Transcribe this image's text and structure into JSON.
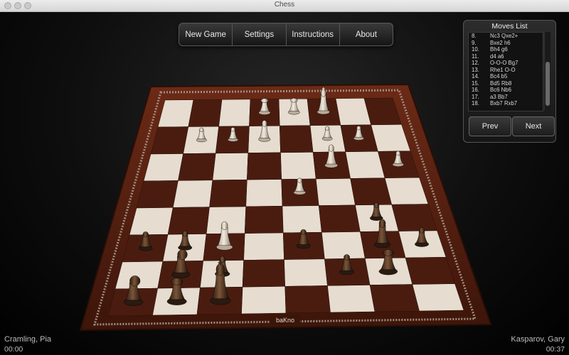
{
  "window": {
    "title": "Chess"
  },
  "menu": [
    {
      "label": "New Game",
      "name": "new-game-button"
    },
    {
      "label": "Settings",
      "name": "settings-button"
    },
    {
      "label": "Instructions",
      "name": "instructions-button"
    },
    {
      "label": "About",
      "name": "about-button"
    }
  ],
  "moves_panel": {
    "title": "Moves List",
    "moves": [
      {
        "num": "8.",
        "text": "Nc3 Qxe2+"
      },
      {
        "num": "9.",
        "text": "Bxe2 h6"
      },
      {
        "num": "10.",
        "text": "Bh4 g6"
      },
      {
        "num": "11.",
        "text": "d4 a6"
      },
      {
        "num": "12.",
        "text": "O-O-O Bg7"
      },
      {
        "num": "13.",
        "text": "Rhe1 O-O"
      },
      {
        "num": "14.",
        "text": "Bc4 b5"
      },
      {
        "num": "15.",
        "text": "Bd5 Rb8"
      },
      {
        "num": "16.",
        "text": "Bc6 Nb6"
      },
      {
        "num": "17.",
        "text": "a3 Bb7"
      },
      {
        "num": "18.",
        "text": "Bxb7 Rxb7"
      }
    ],
    "prev_label": "Prev",
    "next_label": "Next"
  },
  "players": {
    "left": {
      "name": "Cramling, Pia",
      "clock": "00:00"
    },
    "right": {
      "name": "Kasparov, Gary",
      "clock": "00:37"
    }
  },
  "board": {
    "brand": "baKno",
    "light_square": "#e6ddd0",
    "dark_square": "#4a1c10",
    "frame": "#5b2212",
    "white_pieces": [
      {
        "type": "rook",
        "file": 3,
        "rank": 8
      },
      {
        "type": "rook",
        "file": 4,
        "rank": 8
      },
      {
        "type": "king",
        "file": 5,
        "rank": 8
      },
      {
        "type": "pawn",
        "file": 1,
        "rank": 7
      },
      {
        "type": "pawn",
        "file": 2,
        "rank": 7
      },
      {
        "type": "bishop",
        "file": 3,
        "rank": 7
      },
      {
        "type": "pawn",
        "file": 6,
        "rank": 7
      },
      {
        "type": "pawn",
        "file": 5,
        "rank": 7
      },
      {
        "type": "bishop",
        "file": 5,
        "rank": 6
      },
      {
        "type": "pawn",
        "file": 7,
        "rank": 6
      },
      {
        "type": "pawn",
        "file": 4,
        "rank": 5
      },
      {
        "type": "bishop",
        "file": 2,
        "rank": 3
      }
    ],
    "black_pieces": [
      {
        "type": "pawn",
        "file": 6,
        "rank": 4
      },
      {
        "type": "pawn",
        "file": 6,
        "rank": 3
      },
      {
        "type": "bishop",
        "file": 6,
        "rank": 3
      },
      {
        "type": "pawn",
        "file": 7,
        "rank": 3
      },
      {
        "type": "pawn",
        "file": 0,
        "rank": 3
      },
      {
        "type": "pawn",
        "file": 1,
        "rank": 3
      },
      {
        "type": "pawn",
        "file": 4,
        "rank": 3
      },
      {
        "type": "rook",
        "file": 6,
        "rank": 2
      },
      {
        "type": "knight",
        "file": 1,
        "rank": 2
      },
      {
        "type": "pawn",
        "file": 2,
        "rank": 2
      },
      {
        "type": "pawn",
        "file": 5,
        "rank": 2
      },
      {
        "type": "knight",
        "file": 0,
        "rank": 1
      },
      {
        "type": "king",
        "file": 2,
        "rank": 1
      },
      {
        "type": "rook",
        "file": 1,
        "rank": 1
      }
    ]
  }
}
